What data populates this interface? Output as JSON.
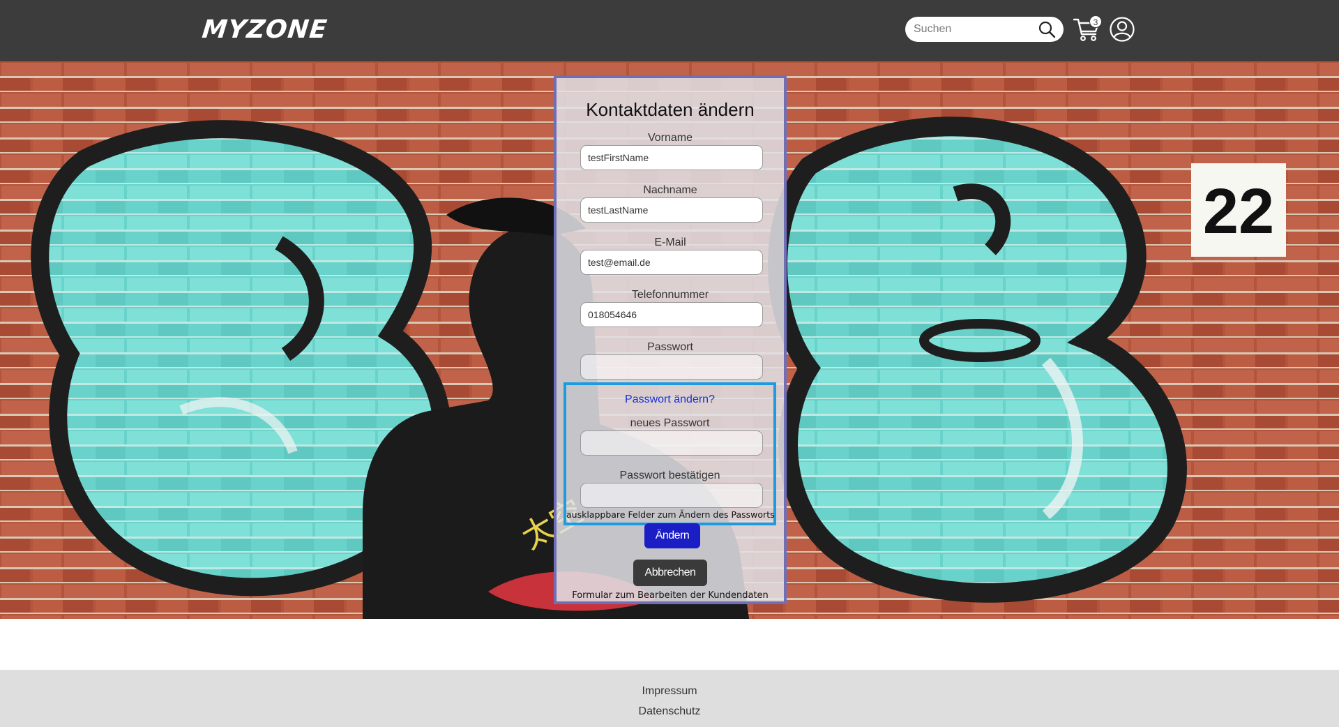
{
  "header": {
    "logo_text": "MYZONE",
    "search": {
      "placeholder": "Suchen",
      "value": ""
    },
    "cart_count": "3",
    "icons": [
      "search-icon",
      "cart-icon",
      "user-account-icon"
    ]
  },
  "hero": {
    "sign_number": "22",
    "colors": {
      "wall_brick": "#b7533a",
      "graffiti_teal": "#6fd8cf",
      "graffiti_outline": "#222222"
    }
  },
  "form": {
    "title": "Kontaktdaten ändern",
    "fields": [
      {
        "label": "Vorname",
        "value": "testFirstName"
      },
      {
        "label": "Nachname",
        "value": "testLastName"
      },
      {
        "label": "E-Mail",
        "value": "test@email.de"
      },
      {
        "label": "Telefonnummer",
        "value": "018054646"
      },
      {
        "label": "Passwort",
        "value": ""
      }
    ],
    "password_change": {
      "toggle_label": "Passwort ändern?",
      "new_password_label": "neues Passwort",
      "confirm_password_label": "Passwort bestätigen",
      "annotation": "ausklappbare Felder zum Ändern des Passworts"
    },
    "submit_label": "Ändern",
    "cancel_label": "Abbrechen",
    "annotation": "Formular zum Bearbeiten der Kundendaten",
    "colors": {
      "card_border": "#6f6fb7",
      "panel_border": "#1c9be0",
      "submit": "#1b1ec4",
      "cancel": "#3a3a3a",
      "link": "#1a2fd1"
    }
  },
  "footer": {
    "links": [
      "Impressum",
      "Datenschutz"
    ]
  }
}
